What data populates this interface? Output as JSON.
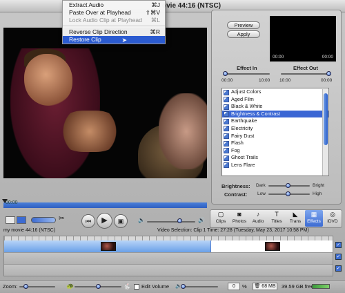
{
  "window": {
    "title_visible": "ovie  44:16 (NTSC)"
  },
  "menu": {
    "items": [
      {
        "label": "Extract Audio",
        "shortcut": "⌘J",
        "state": "normal"
      },
      {
        "label": "Paste Over at Playhead",
        "shortcut": "⇧⌘V",
        "state": "normal"
      },
      {
        "label": "Lock Audio Clip at Playhead",
        "shortcut": "⌘L",
        "state": "disabled"
      },
      {
        "label": "Reverse Clip Direction",
        "shortcut": "⌘R",
        "state": "normal"
      },
      {
        "label": "Restore Clip",
        "shortcut": "",
        "state": "selected"
      }
    ]
  },
  "viewer": {
    "time": "00:00"
  },
  "effects_panel": {
    "preview_label": "Preview",
    "apply_label": "Apply",
    "preview_time_left": "00:00",
    "preview_time_right": "00:00",
    "effect_in_label": "Effect In",
    "effect_out_label": "Effect Out",
    "effect_in_min": "00:00",
    "effect_in_max": "10:00",
    "effect_out_min": "10:00",
    "effect_out_max": "00:00",
    "effects": [
      "Adjust Colors",
      "Aged Film",
      "Black & White",
      "Brightness & Contrast",
      "Earthquake",
      "Electricity",
      "Fairy Dust",
      "Flash",
      "Fog",
      "Ghost Trails",
      "Lens Flare"
    ],
    "selected_effect": "Brightness & Contrast",
    "brightness_label": "Brightness:",
    "brightness_min": "Dark",
    "brightness_max": "Bright",
    "contrast_label": "Contrast:",
    "contrast_min": "Low",
    "contrast_max": "High"
  },
  "toolbar": {
    "tabs": [
      {
        "label": "Clips",
        "icon": "clips-icon",
        "glyph": "▢"
      },
      {
        "label": "Photos",
        "icon": "camera-icon",
        "glyph": "◙"
      },
      {
        "label": "Audio",
        "icon": "speaker-icon",
        "glyph": "♪"
      },
      {
        "label": "Titles",
        "icon": "titles-icon",
        "glyph": "T"
      },
      {
        "label": "Trans",
        "icon": "transition-icon",
        "glyph": "◣"
      },
      {
        "label": "Effects",
        "icon": "effects-icon",
        "glyph": "▦"
      },
      {
        "label": "iDVD",
        "icon": "dvd-icon",
        "glyph": "◎"
      }
    ],
    "active_tab": "Effects"
  },
  "info": {
    "movie": "my movie  44:16 (NTSC)",
    "selection": "Video Selection: Clip 1 Time: 27:28 (Tuesday, May 23, 2017 10:58 PM)"
  },
  "bottom_bar": {
    "zoom_label": "Zoom:",
    "edit_volume_label": "Edit Volume",
    "volume_value": "0",
    "volume_unit": "%",
    "trash_size": "68 MB",
    "disk_free": "39.59 GB free"
  },
  "colors": {
    "accent": "#3a66d4",
    "selection": "#2b5bd0"
  }
}
